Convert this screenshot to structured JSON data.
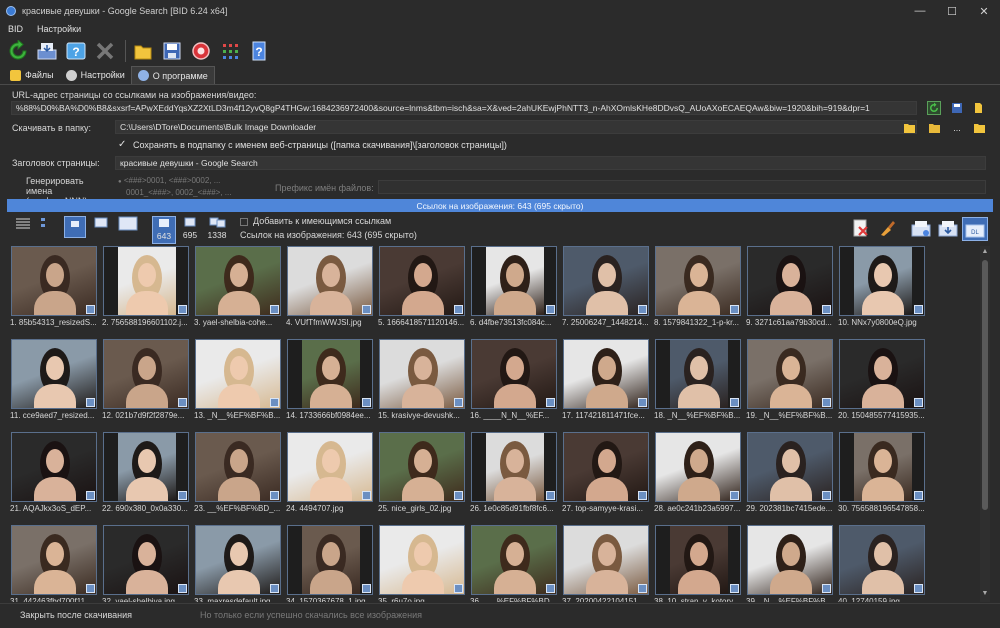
{
  "window": {
    "title": "красивые девушки - Google Search [BID 6.24 x64]",
    "min": "—",
    "max": "☐",
    "close": "✕"
  },
  "menu": [
    "BID",
    "Настройки"
  ],
  "toolbar_icons": [
    "refresh-icon",
    "download-icon",
    "help-icon",
    "stop-icon",
    "folder-icon",
    "save-icon",
    "record-icon",
    "grid-icon",
    "info-icon"
  ],
  "tabs": [
    {
      "label": "Файлы",
      "icon": "folder-icon"
    },
    {
      "label": "Настройки",
      "icon": "gear-icon"
    },
    {
      "label": "О программе",
      "icon": "info-icon"
    }
  ],
  "form": {
    "url_label": "URL-адрес страницы со ссылками на изображения/видео:",
    "url_value": "%88%D0%BA%D0%B8&sxsrf=APwXEddYqsXZ2XtLD3m4f12yvQ8gP4THGw:1684236972400&source=lnms&tbm=isch&sa=X&ved=2ahUKEwjPhNTT3_n-AhXOmlsKHe8DDvsQ_AUoAXoECAEQAw&biw=1920&bih=919&dpr=1",
    "folder_label": "Скачивать в папку:",
    "folder_value": "C:\\Users\\DTore\\Documents\\Bulk Image Downloader",
    "subfolder_check": "Сохранять в подпапку с именем веб-страницы ([папка скачивания]\\[заголовок страницы])",
    "page_title_label": "Заголовок страницы:",
    "page_title_value": "красивые девушки - Google Search",
    "gen_names_label": "Генерировать имена (префиксNNN)",
    "gen_names_hint_1": "<###>0001, <###>0002, ...",
    "gen_names_hint_2": "0001_<###>, 0002_<###>, ...",
    "prefix_label": "Префикс имён файлов:",
    "prefix_value": ""
  },
  "links_bar": "Ссылок на изображения: 643 (695 скрыто)",
  "counts": {
    "a": "643",
    "b": "695",
    "c": "1338"
  },
  "add_links_label": "Добавить к имеющимся ссылкам",
  "links_count_label": "Ссылок на изображения: 643 (695 скрыто)",
  "thumbnails": [
    "1. 85b54313_resizedS...",
    "2. 756588196601102.j...",
    "3. yael-shelbia-cohe...",
    "4. VUfTfmWWJSI.jpg",
    "5. 1666418571120146...",
    "6. d4fbe73513fc084c...",
    "7. 25006247_1448214...",
    "8. 1579841322_1-p-kr...",
    "9. 3271c61aa79b30cd...",
    "10. NNx7y0800eQ.jpg",
    "11. cce9aed7_resized...",
    "12. 021b7d9f2f2879e...",
    "13. _N__%EF%BF%B...",
    "14. 1733666bf0984ee...",
    "15. krasivye-devushk...",
    "16. ____N_N__%EF...",
    "17. 117421811471fce...",
    "18. _N__%EF%BF%B...",
    "19. _N__%EF%BF%B...",
    "20. 150485577415935...",
    "21. AQAJkx3oS_dEP...",
    "22. 690x380_0x0a330...",
    "23. __%EF%BF%BD_...",
    "24. 4494707.jpg",
    "25. nice_girls_02.jpg",
    "26. 1e0c85d91fbf8fc6...",
    "27. top-samyye-krasi...",
    "28. ae0c241b23a5997...",
    "29. 202381bc7415ede...",
    "30. 756588196547858...",
    "31. 442463fbd700f11...",
    "32. yael-shelbiya.jpg",
    "33. maxresdefault.jpg",
    "34. 1570367678_1.jpg",
    "35. r6u7o.jpg",
    "36. ___%EF%BF%BD...",
    "37. 20200422104151...",
    "38. 10_stran_v_kotory...",
    "39. _N__%EF%BF%B...",
    "40. 12740159.jpg"
  ],
  "status": {
    "close_after": "Закрыть после скачивания",
    "only_if": "Но только если успешно скачались все изображения"
  }
}
